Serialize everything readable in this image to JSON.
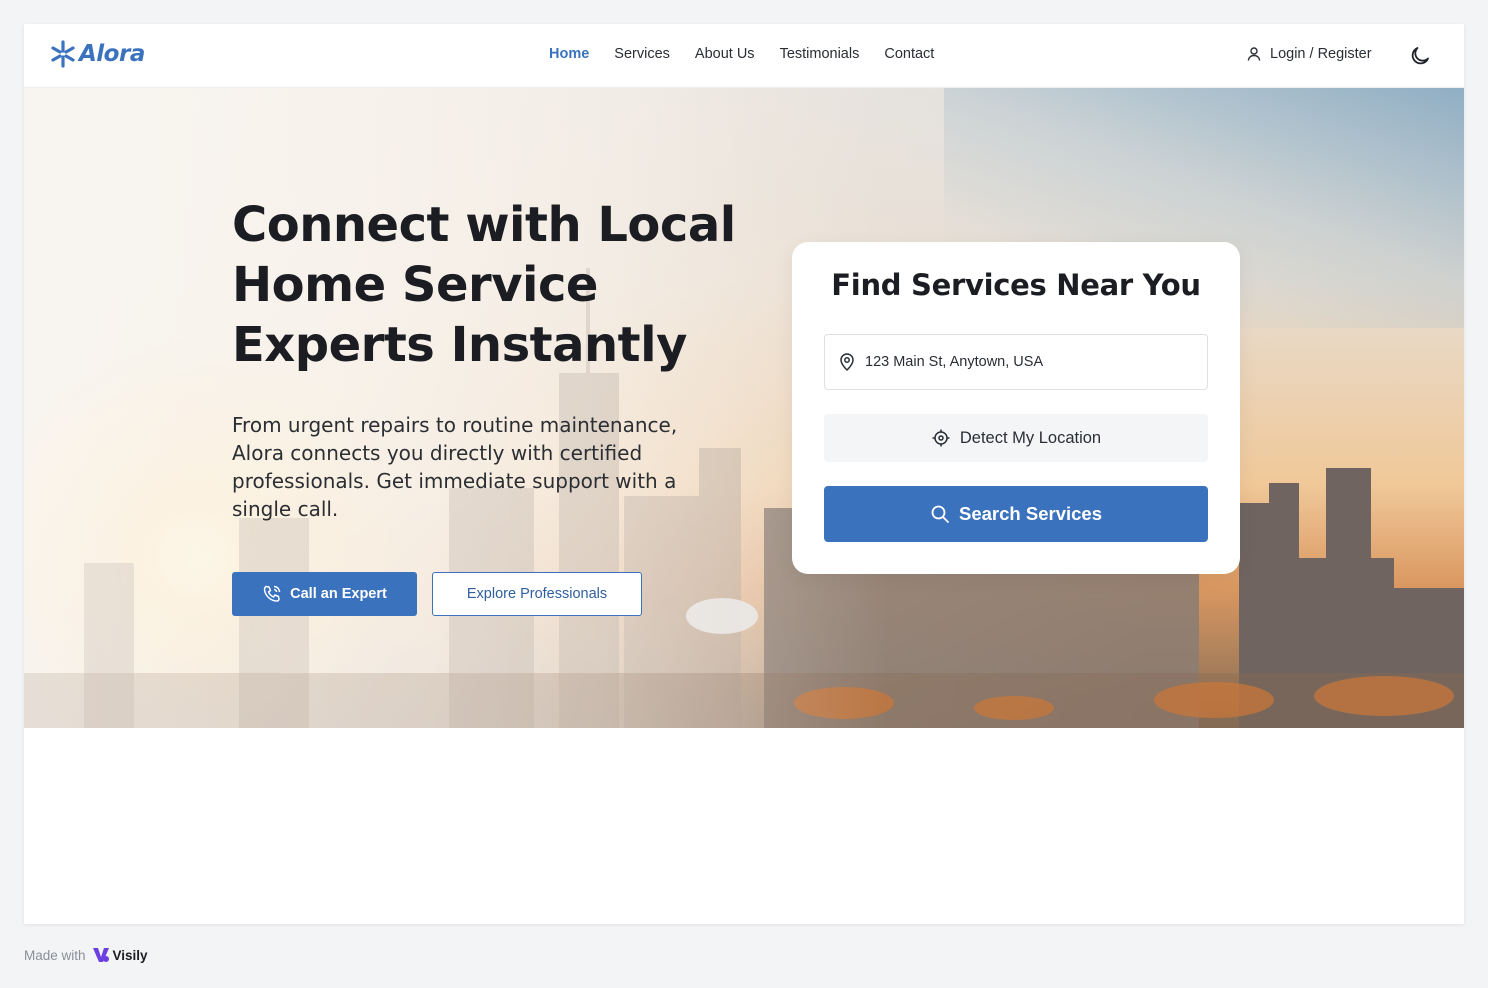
{
  "brand": {
    "name": "Alora",
    "accent": "#3a72be"
  },
  "nav": {
    "items": [
      {
        "label": "Home",
        "active": true
      },
      {
        "label": "Services",
        "active": false
      },
      {
        "label": "About Us",
        "active": false
      },
      {
        "label": "Testimonials",
        "active": false
      },
      {
        "label": "Contact",
        "active": false
      }
    ]
  },
  "header": {
    "login_label": "Login / Register",
    "login_icon": "user-icon",
    "theme_icon": "moon-icon"
  },
  "hero": {
    "headline": "Connect with Local Home Service Experts Instantly",
    "subtext": "From urgent repairs to routine maintenance, Alora connects you directly with certified professionals. Get immediate support with a single call.",
    "call_button": "Call an Expert",
    "call_icon": "phone-icon",
    "explore_button": "Explore Professionals"
  },
  "search_card": {
    "title": "Find Services Near You",
    "address_value": "123 Main St, Anytown, USA",
    "address_icon": "map-pin-icon",
    "detect_label": "Detect My Location",
    "detect_icon": "crosshair-icon",
    "search_label": "Search Services",
    "search_icon": "search-icon"
  },
  "footer": {
    "made_with": "Made with",
    "visily": "Visily"
  }
}
